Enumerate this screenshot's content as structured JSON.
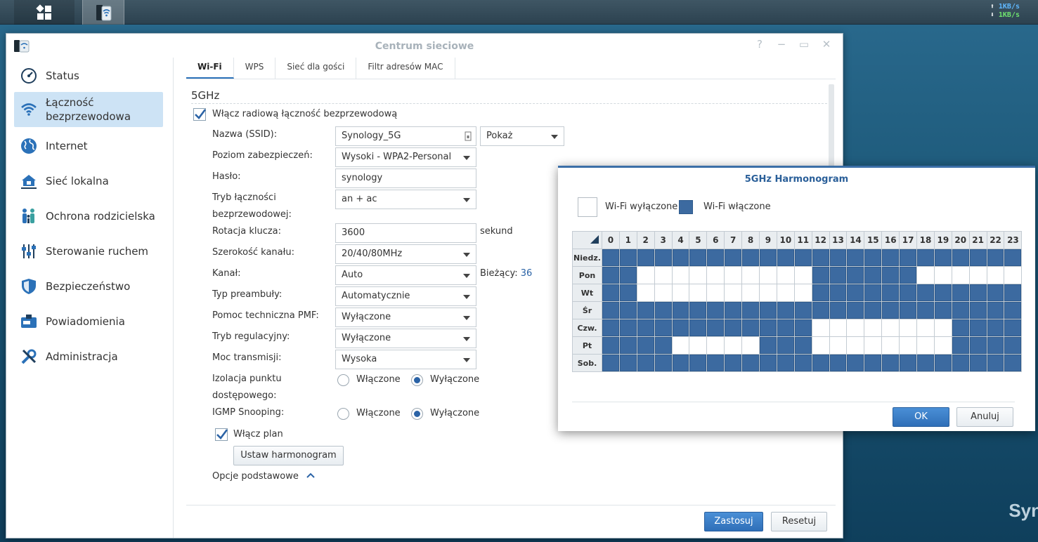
{
  "taskbar": {
    "upload_speed": "1KB/s",
    "download_speed": "1KB/s"
  },
  "window": {
    "title": "Centrum sieciowe",
    "help": "?"
  },
  "sidebar": {
    "items": [
      {
        "label": "Status",
        "icon": "gauge-icon"
      },
      {
        "label": "Łączność bezprzewodowa",
        "icon": "wifi-icon"
      },
      {
        "label": "Internet",
        "icon": "globe-icon"
      },
      {
        "label": "Sieć lokalna",
        "icon": "home-network-icon"
      },
      {
        "label": "Ochrona rodzicielska",
        "icon": "family-icon"
      },
      {
        "label": "Sterowanie ruchem",
        "icon": "sliders-icon"
      },
      {
        "label": "Bezpieczeństwo",
        "icon": "shield-icon"
      },
      {
        "label": "Powiadomienia",
        "icon": "mailbox-icon"
      },
      {
        "label": "Administracja",
        "icon": "tools-icon"
      }
    ]
  },
  "tabs": [
    "Wi-Fi",
    "WPS",
    "Sieć dla gości",
    "Filtr adresów MAC"
  ],
  "section": {
    "title": "5GHz",
    "enable_radio_label": "Włącz radiową łączność bezprzewodową"
  },
  "form": {
    "ssid_label": "Nazwa (SSID):",
    "ssid_value": "Synology_5G",
    "ssid_visibility": "Pokaż",
    "security_label": "Poziom zabezpieczeń:",
    "security_value": "Wysoki - WPA2-Personal",
    "password_label": "Hasło:",
    "password_value": "synology",
    "mode_label_1": "Tryb łączności",
    "mode_label_2": "bezprzewodowej:",
    "mode_value": "an + ac",
    "key_rotation_label": "Rotacja klucza:",
    "key_rotation_value": "3600",
    "key_rotation_unit": "sekund",
    "bandwidth_label": "Szerokość kanału:",
    "bandwidth_value": "20/40/80MHz",
    "channel_label": "Kanał:",
    "channel_value": "Auto",
    "current_label": "Bieżący:",
    "current_value": "36",
    "preamble_label": "Typ preambuły:",
    "preamble_value": "Automatycznie",
    "pmf_label": "Pomoc techniczna PMF:",
    "pmf_value": "Wyłączone",
    "regulatory_label": "Tryb regulacyjny:",
    "regulatory_value": "Wyłączone",
    "power_label": "Moc transmisji:",
    "power_value": "Wysoka",
    "ap_isolation_label_1": "Izolacja punktu",
    "ap_isolation_label_2": "dostępowego:",
    "igmp_label": "IGMP Snooping:",
    "radio_on": "Włączone",
    "radio_off": "Wyłączone",
    "enable_plan_label": "Włącz plan",
    "set_schedule_button": "Ustaw harmonogram",
    "basic_options_link": "Opcje podstawowe"
  },
  "footer": {
    "apply": "Zastosuj",
    "reset": "Resetuj"
  },
  "dialog": {
    "title": "5GHz Harmonogram",
    "legend_off": "Wi-Fi wyłączone",
    "legend_on": "Wi-Fi włączone",
    "hours": [
      "0",
      "1",
      "2",
      "3",
      "4",
      "5",
      "6",
      "7",
      "8",
      "9",
      "10",
      "11",
      "12",
      "13",
      "14",
      "15",
      "16",
      "17",
      "18",
      "19",
      "20",
      "21",
      "22",
      "23"
    ],
    "days": [
      "Niedz.",
      "Pon",
      "Wt",
      "Śr",
      "Czw.",
      "Pt",
      "Sob."
    ],
    "schedule": [
      "111111111111111111111111",
      "110000000000111111000000",
      "110000000000111111111111",
      "111111111111111111111111",
      "111111111111000000001111",
      "111100000111000000001111",
      "111111111111111111111111"
    ],
    "ok": "OK",
    "cancel": "Anuluj",
    "colors": {
      "on": "#3c6aa0",
      "off": "#ffffff"
    }
  }
}
